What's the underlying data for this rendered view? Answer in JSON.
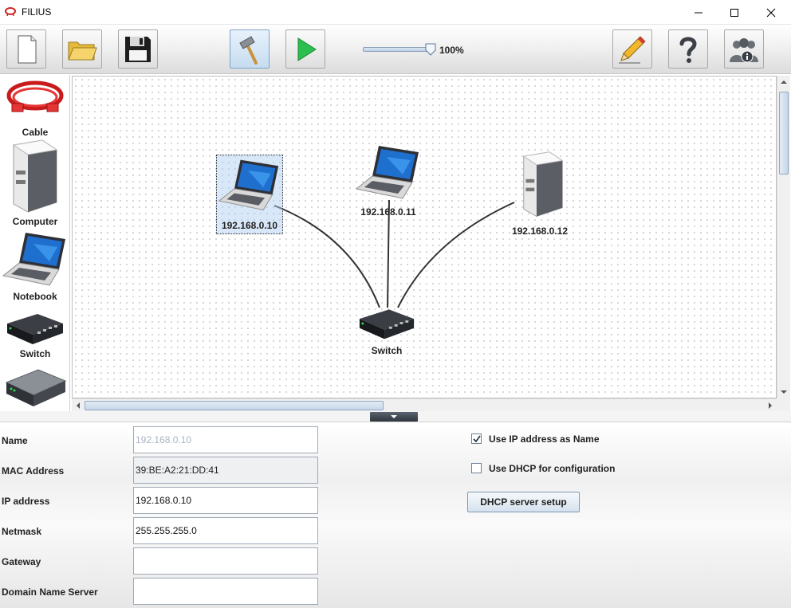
{
  "window": {
    "title": "FILIUS",
    "controls": [
      "minimize",
      "maximize",
      "close"
    ]
  },
  "toolbar": {
    "buttons": [
      {
        "name": "new",
        "icon": "new-file-icon"
      },
      {
        "name": "open",
        "icon": "folder-icon"
      },
      {
        "name": "save",
        "icon": "floppy-disk-icon"
      },
      {
        "name": "design-mode",
        "icon": "hammer-icon",
        "active": true
      },
      {
        "name": "simulation-mode",
        "icon": "play-icon"
      },
      {
        "name": "documentation",
        "icon": "pencil-icon"
      },
      {
        "name": "help",
        "icon": "question-mark-icon"
      },
      {
        "name": "about",
        "icon": "people-info-icon"
      }
    ],
    "zoom": {
      "value": 1.0,
      "label": "100%"
    }
  },
  "palette": {
    "items": [
      {
        "label": "Cable",
        "icon": "cable-icon"
      },
      {
        "label": "Computer",
        "icon": "computer-tower-icon"
      },
      {
        "label": "Notebook",
        "icon": "notebook-icon"
      },
      {
        "label": "Switch",
        "icon": "switch-icon"
      },
      {
        "label": "",
        "icon": "router-icon"
      }
    ]
  },
  "network": {
    "nodes": [
      {
        "label": "192.168.0.10",
        "type": "notebook",
        "selected": true
      },
      {
        "label": "192.168.0.11",
        "type": "notebook",
        "selected": false
      },
      {
        "label": "192.168.0.12",
        "type": "computer",
        "selected": false
      },
      {
        "label": "Switch",
        "type": "switch",
        "selected": false
      }
    ]
  },
  "properties": {
    "fields": [
      {
        "label": "Name",
        "value": "192.168.0.10"
      },
      {
        "label": "MAC Address",
        "value": "39:BE:A2:21:DD:41"
      },
      {
        "label": "IP address",
        "value": "192.168.0.10"
      },
      {
        "label": "Netmask",
        "value": "255.255.255.0"
      },
      {
        "label": "Gateway",
        "value": ""
      },
      {
        "label": "Domain Name Server",
        "value": ""
      }
    ],
    "use_ip_as_name": {
      "label": "Use IP address as Name",
      "checked": true
    },
    "use_dhcp": {
      "label": "Use DHCP for configuration",
      "checked": false
    },
    "dhcp_button": "DHCP server setup"
  }
}
